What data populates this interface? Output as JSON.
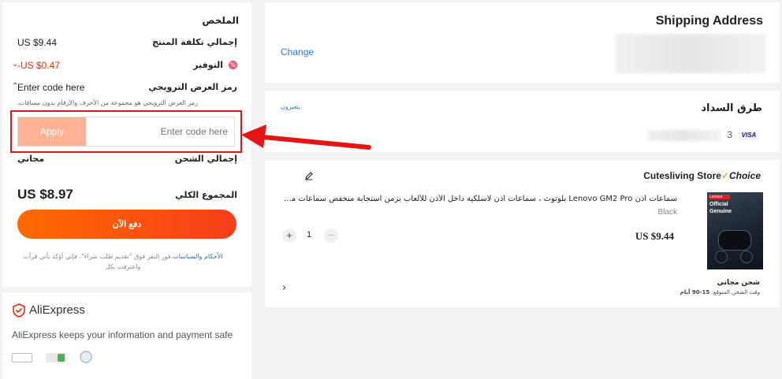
{
  "summary": {
    "title": "الملخص",
    "product_total_label": "إجمالي تكلفة المنتج",
    "product_total_value": "US $9.44",
    "savings_label": "التوفير",
    "savings_value": "-US $0.47",
    "promo_label": "رمز العرض الترويجي",
    "promo_toggle_text": "Enter code here",
    "promo_description": "رمز العرض الترويجي هو مجموعة من الأحرف والأرقام بدون مسافات.",
    "promo_placeholder": "Enter code here",
    "apply_label": "Apply",
    "shipping_total_label": "إجمالي الشحن",
    "shipping_total_value": "مجاني",
    "grand_total_label": "المجموع الكلي",
    "grand_total_value": "US $8.97",
    "pay_button_label": "دفع الآن",
    "terms_link": "الأحكام والسياسات",
    "terms_text": "،فور النقر فوق \"تقديم طلب شراء\"، فإني أؤكد بأني قرأت واعترفت بكل"
  },
  "trust": {
    "brand": "AliExpress",
    "message": "AliExpress keeps your information and payment safe"
  },
  "shipping": {
    "title": "Shipping Address",
    "change_label": "Change"
  },
  "payment": {
    "title": "طرق السداد",
    "change_label": "يتغيرون",
    "card_suffix": "3",
    "card_brand": "VISA"
  },
  "store": {
    "name": "Cutesliving Store",
    "choice_badge": "Choice",
    "product_title": "سماعات أذن Lenovo GM2 Pro بلوتوث ، سماعات أذن لاسلكية داخل الأذن للألعاب بزمن استجابة منخفض سماعات موسيقى م...",
    "variant": "Black",
    "price": "US $9.44",
    "quantity": "1",
    "image_label_1": "Lenovo",
    "image_label_2": "Official",
    "image_label_3": "Genuine",
    "shipping_label": "شحن مجاني",
    "delivery_label": "وقت الشحن المتوقع:",
    "delivery_value": "15-90 أيام"
  },
  "colors": {
    "accent": "#ff4b0f",
    "apply_disabled": "#ffb296",
    "highlight_red": "#e41515",
    "link_blue": "#2e7ad9"
  }
}
